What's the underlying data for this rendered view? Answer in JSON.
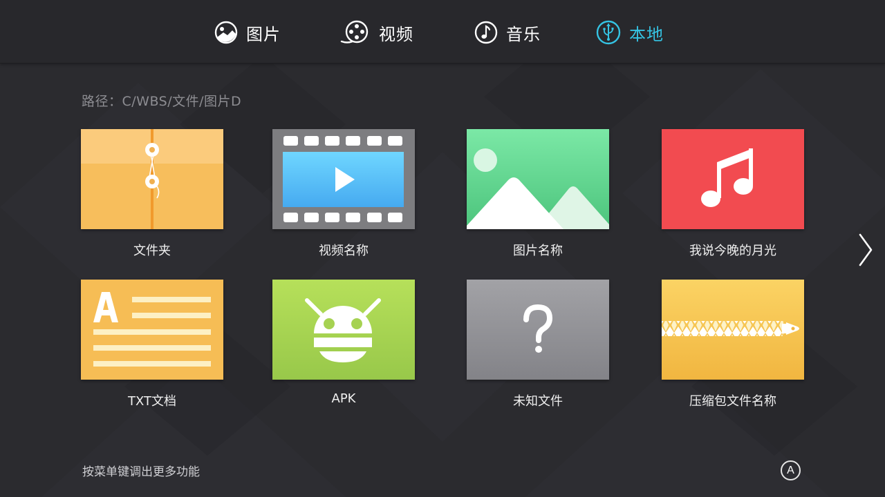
{
  "nav": {
    "tabs": [
      {
        "label": "图片",
        "icon": "image-icon",
        "active": false
      },
      {
        "label": "视频",
        "icon": "film-reel-icon",
        "active": false
      },
      {
        "label": "音乐",
        "icon": "music-note-icon",
        "active": false
      },
      {
        "label": "本地",
        "icon": "usb-icon",
        "active": true
      }
    ],
    "active_color": "#35c4e4"
  },
  "path": {
    "text": "路径：C/WBS/文件/图片D"
  },
  "files": [
    {
      "name": "文件夹",
      "type": "folder",
      "icon": "folder-icon",
      "color": "#f8c062"
    },
    {
      "name": "视频名称",
      "type": "video",
      "icon": "video-file-icon",
      "color": "#808080"
    },
    {
      "name": "图片名称",
      "type": "image",
      "icon": "image-file-icon",
      "color": "#6fdc9c"
    },
    {
      "name": "我说今晚的月光",
      "type": "music",
      "icon": "music-file-icon",
      "color": "#f24e52"
    },
    {
      "name": "TXT文档",
      "type": "txt",
      "icon": "text-document-icon",
      "color": "#f7be55"
    },
    {
      "name": "APK",
      "type": "apk",
      "icon": "android-icon",
      "color": "#a8d452"
    },
    {
      "name": "未知文件",
      "type": "unknown",
      "icon": "question-mark-icon",
      "color": "#909095"
    },
    {
      "name": "压缩包文件名称",
      "type": "zip",
      "icon": "zip-archive-icon",
      "color": "#f7c650"
    }
  ],
  "footer": {
    "hint": "按菜单键调出更多功能",
    "button_label": "A"
  },
  "icons": {
    "next": "chevron-right-icon"
  }
}
